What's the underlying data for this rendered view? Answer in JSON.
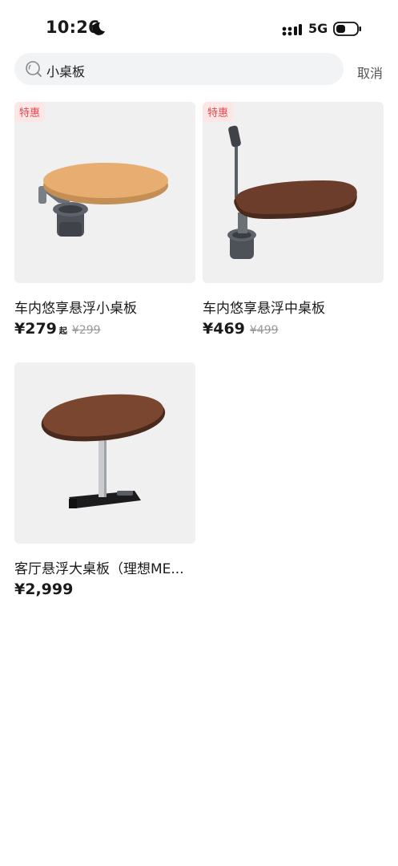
{
  "status_bar": {
    "time": "10:26",
    "network": "5G",
    "icons": [
      "moon-icon",
      "signal-icon",
      "battery-icon"
    ]
  },
  "search": {
    "query": "小桌板",
    "cancel_label": "取消",
    "icon": "search-icon"
  },
  "colors": {
    "promo_tag_bg": "#fde6e6",
    "promo_tag_text": "#e5484d",
    "card_bg": "#f0f0f0",
    "search_bg": "#f2f3f5"
  },
  "products": [
    {
      "title": "车内悠享悬浮小桌板",
      "price": "¥279",
      "price_suffix": "起",
      "old_price": "¥299",
      "tag": "特惠"
    },
    {
      "title": "车内悠享悬浮中桌板",
      "price": "¥469",
      "old_price": "¥499",
      "tag": "特惠"
    },
    {
      "title": "客厅悬浮大桌板（理想ME...",
      "price": "¥2,999"
    }
  ]
}
